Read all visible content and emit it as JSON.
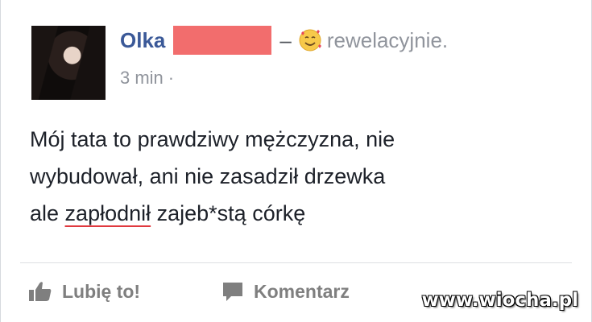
{
  "post": {
    "author_name": "Olka",
    "feeling_separator": "–",
    "feeling_text": "rewelacyjnie.",
    "feeling_icon": "smiling-face-with-hearts-icon",
    "timestamp": "3 min",
    "privacy_dot": "·",
    "body_line1": "Mój tata to prawdziwy mężczyzna, nie",
    "body_line2": "wybudował, ani nie zasadził drzewka",
    "body_line3_prefix": "ale ",
    "body_line3_underlined": "zapłodnił",
    "body_line3_suffix": " zajeb*stą córkę"
  },
  "actions": {
    "like_label": "Lubię to!",
    "comment_label": "Komentarz",
    "like_icon": "thumbs-up-icon",
    "comment_icon": "speech-bubble-icon"
  },
  "watermark": "www.wiocha.pl",
  "colors": {
    "name_blue": "#3b5998",
    "redaction": "#f26d6d",
    "muted": "#90949c",
    "spellcheck_underline": "#e0393e"
  }
}
